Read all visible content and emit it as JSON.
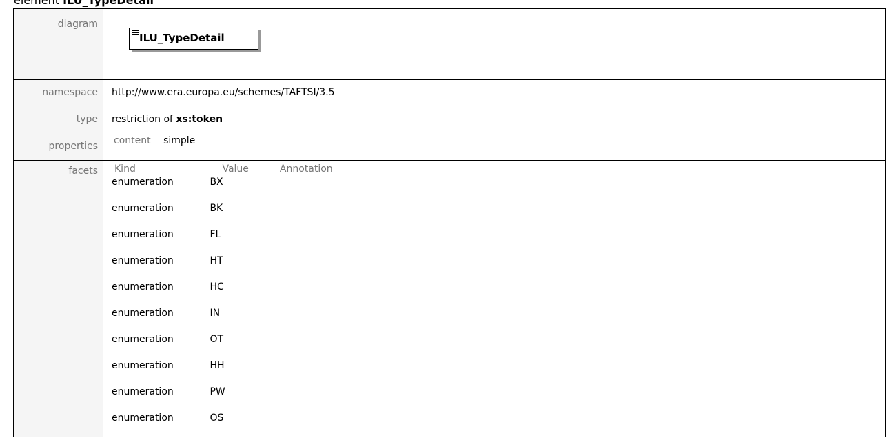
{
  "header": {
    "prefix": "element",
    "name": "ILU_TypeDetail"
  },
  "rows": {
    "diagram": {
      "label": "diagram",
      "element_name": "ILU_TypeDetail"
    },
    "namespace": {
      "label": "namespace",
      "value": "http://www.era.europa.eu/schemes/TAFTSI/3.5"
    },
    "type": {
      "label": "type",
      "prefix": "restriction of",
      "base": "xs:token"
    },
    "properties": {
      "label": "properties",
      "key": "content",
      "value": "simple"
    },
    "facets": {
      "label": "facets",
      "columns": [
        "Kind",
        "Value",
        "Annotation"
      ],
      "items": [
        {
          "kind": "enumeration",
          "value": "BX"
        },
        {
          "kind": "enumeration",
          "value": "BK"
        },
        {
          "kind": "enumeration",
          "value": "FL"
        },
        {
          "kind": "enumeration",
          "value": "HT"
        },
        {
          "kind": "enumeration",
          "value": "HC"
        },
        {
          "kind": "enumeration",
          "value": "IN"
        },
        {
          "kind": "enumeration",
          "value": "OT"
        },
        {
          "kind": "enumeration",
          "value": "HH"
        },
        {
          "kind": "enumeration",
          "value": "PW"
        },
        {
          "kind": "enumeration",
          "value": "OS"
        }
      ]
    }
  }
}
